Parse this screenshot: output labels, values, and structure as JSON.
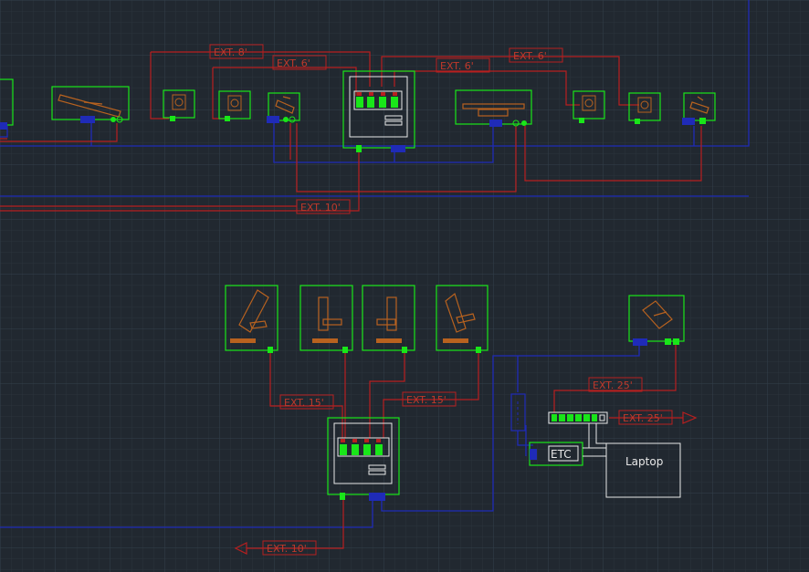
{
  "colors": {
    "background": "#212830",
    "grid_minor": "#2b333c",
    "grid_major": "#34404b",
    "device_outline": "#19e619",
    "cable_red": "#b81f1f",
    "cable_blue": "#1f2bb8",
    "fixture": "#b8621f",
    "label_red": "#c0392b",
    "white": "#e8e8e8"
  },
  "ext_labels": {
    "t1": "EXT. 8'",
    "t2": "EXT. 6'",
    "t3": "EXT. 6'",
    "t4": "EXT. 6'",
    "t5": "EXT. 10'",
    "t6": "EXT. 15'",
    "t7": "EXT. 15'",
    "t8": "EXT. 25'",
    "t9": "EXT. 25'",
    "t10": "EXT. 10'"
  },
  "devices": {
    "etc": "ETC",
    "laptop": "Laptop"
  }
}
